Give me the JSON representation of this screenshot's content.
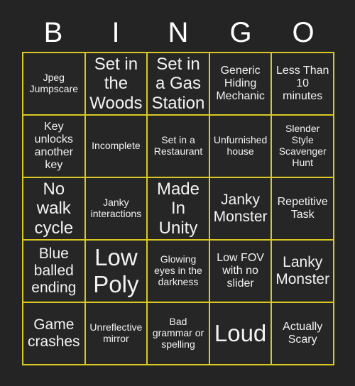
{
  "card": {
    "title": "BINGO",
    "header_letters": [
      "B",
      "I",
      "N",
      "G",
      "O"
    ],
    "colors": {
      "page_background": "#242424",
      "cell_background": "#262626",
      "grid_border": "#d9c922",
      "text": "#f2f2f2",
      "header_text": "#ffffff"
    },
    "grid_size": "5x5",
    "rows": [
      [
        {
          "text": "Jpeg Jumpscare",
          "size": "sm"
        },
        {
          "text": "Set in the Woods",
          "size": "xl"
        },
        {
          "text": "Set in a Gas Station",
          "size": "xl"
        },
        {
          "text": "Generic Hiding Mechanic",
          "size": "md"
        },
        {
          "text": "Less Than 10 minutes",
          "size": "md"
        }
      ],
      [
        {
          "text": "Key unlocks another key",
          "size": "md"
        },
        {
          "text": "Incomplete",
          "size": "sm"
        },
        {
          "text": "Set in a Restaurant",
          "size": "sm"
        },
        {
          "text": "Unfurnished house",
          "size": "sm"
        },
        {
          "text": "Slender Style Scavenger Hunt",
          "size": "sm"
        }
      ],
      [
        {
          "text": "No walk cycle",
          "size": "xl"
        },
        {
          "text": "Janky interactions",
          "size": "sm"
        },
        {
          "text": "Made In Unity",
          "size": "xl"
        },
        {
          "text": "Janky Monster",
          "size": "lg"
        },
        {
          "text": "Repetitive Task",
          "size": "md"
        }
      ],
      [
        {
          "text": "Blue balled ending",
          "size": "lg"
        },
        {
          "text": "Low Poly",
          "size": "xxl"
        },
        {
          "text": "Glowing eyes in the darkness",
          "size": "sm"
        },
        {
          "text": "Low FOV with no slider",
          "size": "md"
        },
        {
          "text": "Lanky Monster",
          "size": "lg"
        }
      ],
      [
        {
          "text": "Game crashes",
          "size": "lg"
        },
        {
          "text": "Unreflective mirror",
          "size": "sm"
        },
        {
          "text": "Bad grammar or spelling",
          "size": "sm"
        },
        {
          "text": "Loud",
          "size": "xxl"
        },
        {
          "text": "Actually Scary",
          "size": "md"
        }
      ]
    ]
  }
}
